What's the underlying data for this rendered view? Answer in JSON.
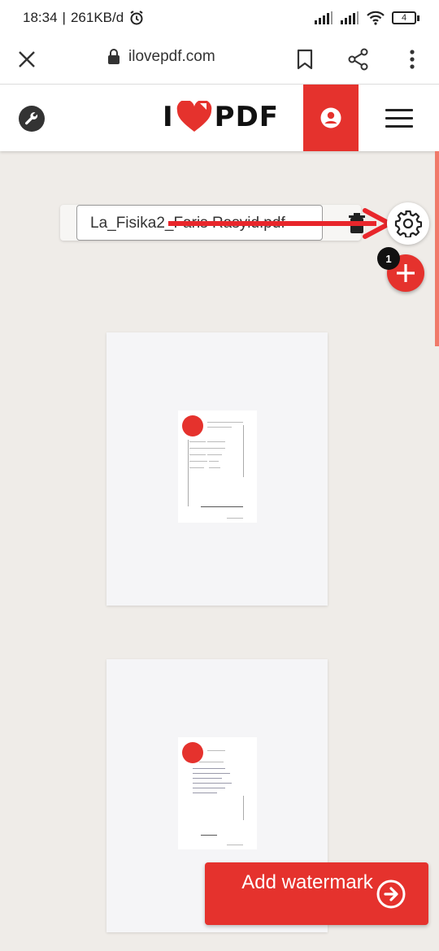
{
  "status_bar": {
    "time": "18:34",
    "data_rate": "261KB/d",
    "battery": "4"
  },
  "browser": {
    "url": "ilovepdf.com",
    "icons": [
      "close-icon",
      "lock-icon",
      "bookmark-icon",
      "share-icon",
      "more-vertical-icon"
    ]
  },
  "header": {
    "logo_left": "I",
    "logo_right": "PDF",
    "brand_color": "#e5322d"
  },
  "file": {
    "name": "La_Fisika2_Faris Rasyid.pdf",
    "file_count": "1"
  },
  "action": {
    "label": "Add watermark"
  },
  "colors": {
    "accent": "#e5322d",
    "background": "#efece8",
    "annotation_arrow": "#e8262b"
  }
}
